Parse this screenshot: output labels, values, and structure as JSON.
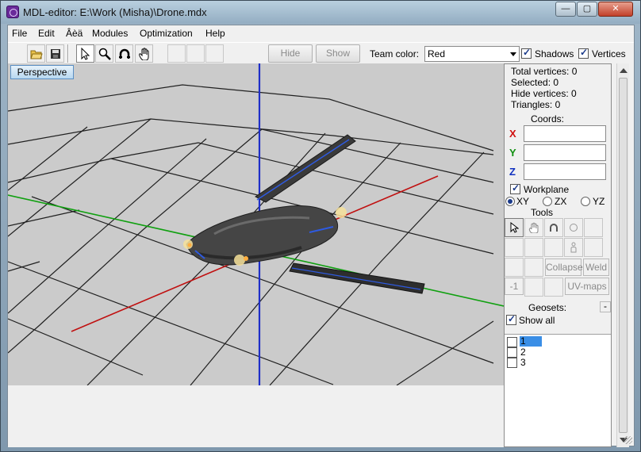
{
  "window": {
    "title": "MDL-editor: E:\\Work (Misha)\\Drone.mdx",
    "controls": {
      "minimize": "—",
      "maximize": "▢",
      "close": "✕"
    }
  },
  "menu": {
    "items": [
      "File",
      "Edit",
      "Âèä",
      "Modules",
      "Optimization",
      "Help"
    ]
  },
  "toolbar": {
    "hide_label": "Hide",
    "show_label": "Show",
    "team_color_label": "Team color:",
    "team_color_value": "Red",
    "shadows_label": "Shadows",
    "shadows_checked": true,
    "vertices_label": "Vertices",
    "vertices_checked": true,
    "icons": [
      "open-folder-icon",
      "save-disk-icon",
      "select-arrow-icon",
      "zoom-magnifier-icon",
      "rotate-icon",
      "pan-hand-icon"
    ]
  },
  "viewport": {
    "mode_label": "Perspective",
    "colors": {
      "background": "#cbcbcb",
      "grid": "#202020",
      "axis_z": "#1f2fc8",
      "axis_x": "#c01010",
      "axis_y": "#10a010"
    }
  },
  "panel": {
    "total_vertices": "Total vertices: 0",
    "selected": "Selected: 0",
    "hide_vertices": "Hide vertices: 0",
    "triangles": "Triangles: 0",
    "coords_label": "Coords:",
    "x_label": "X",
    "y_label": "Y",
    "z_label": "Z",
    "x_value": "",
    "y_value": "",
    "z_value": "",
    "workplane_label": "Workplane",
    "workplane_checked": true,
    "plane_options": [
      "XY",
      "ZX",
      "YZ"
    ],
    "plane_selected": "XY",
    "tools_label": "Tools",
    "collapse_label": "Collapse",
    "weld_label": "Weld",
    "minus_one_label": "-1",
    "uvmaps_label": "UV-maps",
    "geosets_label": "Geosets:",
    "geosets_collapse": "-",
    "show_all_label": "Show all",
    "show_all_checked": true,
    "geosets": [
      "1",
      "2",
      "3"
    ],
    "geoset_selected": "1"
  }
}
